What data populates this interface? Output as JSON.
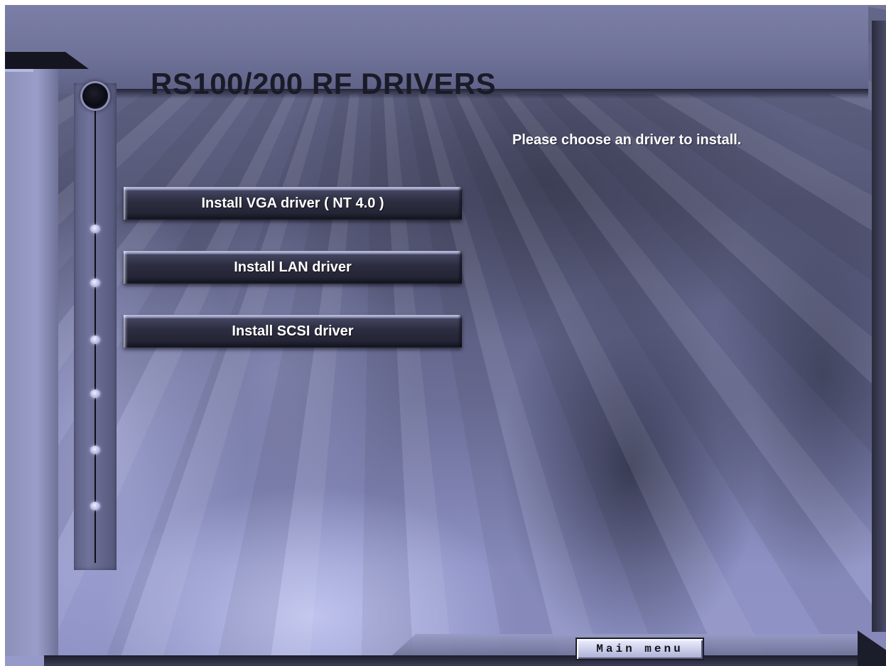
{
  "window": {
    "title": "RS100/200 RF DRIVERS"
  },
  "instruction": {
    "text": "Please choose an driver to install."
  },
  "buttons": [
    {
      "label": "Install VGA driver ( NT 4.0 )"
    },
    {
      "label": "Install LAN driver"
    },
    {
      "label": "Install SCSI driver"
    }
  ],
  "footer": {
    "main_menu_label": "Main menu"
  },
  "colors": {
    "background": "#6a6d90",
    "title": "#1a1b28",
    "button_face": "#2c2d40",
    "button_text": "#ffffff",
    "main_menu_face": "#c9cce8"
  }
}
